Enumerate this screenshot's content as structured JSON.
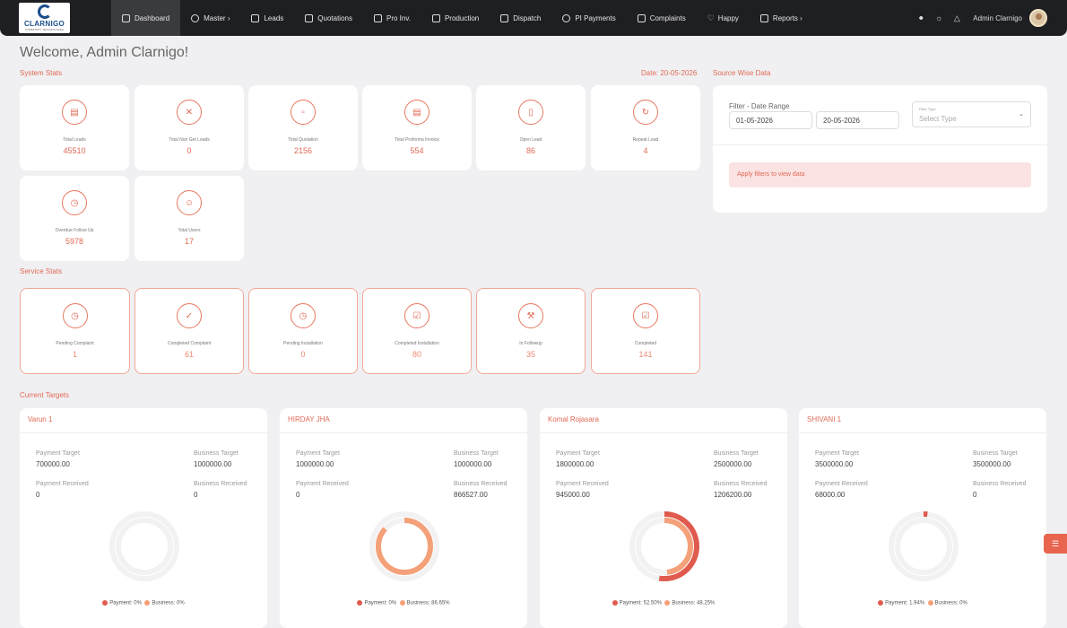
{
  "nav": {
    "logo": {
      "text": "CLARNIGO",
      "sub": "COMMUNITY TECHNOLOGIES"
    },
    "items": [
      {
        "label": "Dashboard",
        "icon": "store-icon"
      },
      {
        "label": "Master ›",
        "icon": "gear-icon"
      },
      {
        "label": "Leads",
        "icon": "leads-icon"
      },
      {
        "label": "Quotations",
        "icon": "clipboard-icon"
      },
      {
        "label": "Pro Inv.",
        "icon": "invoice-icon"
      },
      {
        "label": "Production",
        "icon": "bar-chart-icon"
      },
      {
        "label": "Dispatch",
        "icon": "truck-icon"
      },
      {
        "label": "PI Payments",
        "icon": "coin-icon"
      },
      {
        "label": "Complaints",
        "icon": "document-icon"
      },
      {
        "label": "Happy",
        "icon": "heart-icon"
      },
      {
        "label": "Reports ›",
        "icon": "report-icon"
      }
    ],
    "user": "Admin Clarnigo"
  },
  "welcome": "Welcome, Admin Clarnigo!",
  "system_stats": {
    "title": "System Stats",
    "date": "Date: 20-05-2026",
    "cards": [
      {
        "label": "Total Leads",
        "value": "45510",
        "icon": "list-icon"
      },
      {
        "label": "Total Non Get Leads",
        "value": "0",
        "icon": "close-icon"
      },
      {
        "label": "Total Quotation",
        "value": "2156",
        "icon": "clipboard-icon"
      },
      {
        "label": "Total Proforma Invoice",
        "value": "554",
        "icon": "invoice-icon"
      },
      {
        "label": "Open Lead",
        "value": "86",
        "icon": "bookmark-icon"
      },
      {
        "label": "Repeat Lead",
        "value": "4",
        "icon": "repeat-icon"
      },
      {
        "label": "Overdue Follow Up",
        "value": "5978",
        "icon": "clock-icon"
      },
      {
        "label": "Total Users",
        "value": "17",
        "icon": "user-icon"
      }
    ]
  },
  "service_stats": {
    "title": "Service Stats",
    "cards": [
      {
        "label": "Pending Complaint",
        "value": "1",
        "icon": "clock-icon"
      },
      {
        "label": "Completed Complaint",
        "value": "61",
        "icon": "check-icon"
      },
      {
        "label": "Pending Installation",
        "value": "0",
        "icon": "gauge-icon"
      },
      {
        "label": "Completed Installation",
        "value": "80",
        "icon": "checklist-icon"
      },
      {
        "label": "In Followup",
        "value": "35",
        "icon": "wrench-icon"
      },
      {
        "label": "Completed",
        "value": "141",
        "icon": "checklist-icon"
      }
    ]
  },
  "source_wise": {
    "title": "Source Wise Data",
    "filter_label": "Filter - Date Range",
    "from": "01-05-2026",
    "to": "20-05-2026",
    "type_label": "Filter Type",
    "type_placeholder": "Select Type",
    "alert": "Apply filters to view data"
  },
  "targets": {
    "title": "Current Targets",
    "labels": {
      "payment_target": "Payment Target",
      "business_target": "Business Target",
      "payment_received": "Payment Received",
      "business_received": "Business Received"
    },
    "colors": {
      "payment": "#e05a4e",
      "business": "#f4a079",
      "track": "#f2f2f2"
    },
    "people": [
      {
        "name": "Varun 1",
        "payment_target": "700000.00",
        "business_target": "1000000.00",
        "payment_received": "0",
        "business_received": "0",
        "payment_pct": 0,
        "business_pct": 0,
        "legend_payment": "Payment: 0%",
        "legend_business": "Business: 0%"
      },
      {
        "name": "HIRDAY JHA",
        "payment_target": "1000000.00",
        "business_target": "1000000.00",
        "payment_received": "0",
        "business_received": "866527.00",
        "payment_pct": 0,
        "business_pct": 86.65,
        "legend_payment": "Payment: 0%",
        "legend_business": "Business: 86.65%"
      },
      {
        "name": "Komal Rojasara",
        "payment_target": "1800000.00",
        "business_target": "2500000.00",
        "payment_received": "945000.00",
        "business_received": "1206200.00",
        "payment_pct": 52.5,
        "business_pct": 48.25,
        "legend_payment": "Payment: 52.50%",
        "legend_business": "Business: 48.25%"
      },
      {
        "name": "SHIVANI 1",
        "payment_target": "3500000.00",
        "business_target": "3500000.00",
        "payment_received": "68000.00",
        "business_received": "0",
        "payment_pct": 1.94,
        "business_pct": 0,
        "legend_payment": "Payment: 1.94%",
        "legend_business": "Business: 0%"
      }
    ]
  }
}
